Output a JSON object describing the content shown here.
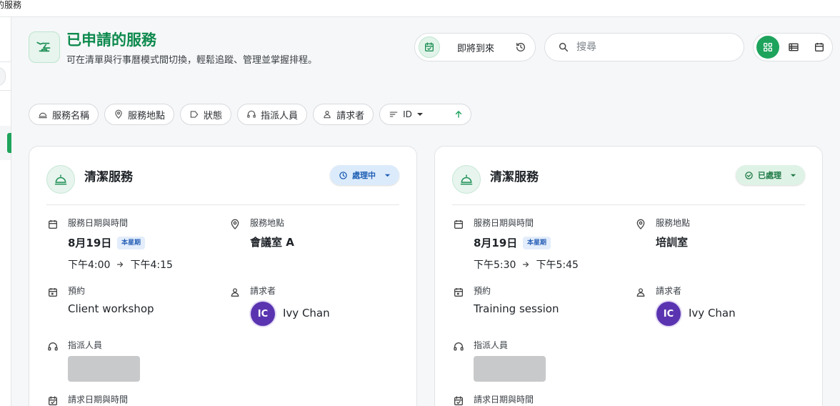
{
  "window": {
    "title": "的服務"
  },
  "header": {
    "title": "已申請的服務",
    "subtitle": "可在清單與行事曆模式間切換，輕鬆追蹤、管理並掌握排程。"
  },
  "toolbar": {
    "upcoming_label": "即將到來",
    "search_placeholder": "搜尋",
    "view_active": "grid"
  },
  "filters": [
    {
      "label": "服務名稱",
      "icon": "service-bell-icon"
    },
    {
      "label": "服務地點",
      "icon": "location-pin-icon"
    },
    {
      "label": "狀態",
      "icon": "tag-icon"
    },
    {
      "label": "指派人員",
      "icon": "headset-icon"
    },
    {
      "label": "請求者",
      "icon": "person-icon"
    }
  ],
  "sort": {
    "field": "ID",
    "direction": "ascending"
  },
  "labels": {
    "service_datetime": "服務日期與時間",
    "location": "服務地點",
    "booking": "預約",
    "requester": "請求者",
    "assignee": "指派人員",
    "request_datetime": "請求日期與時間"
  },
  "cards": [
    {
      "title": "清潔服務",
      "status": "處理中",
      "status_color": "#1e5fb4",
      "date": "8月19日",
      "week_badge": "本星期",
      "time_start": "下午4:00",
      "time_end": "下午4:15",
      "location": "會議室 A",
      "booking": "Client workshop",
      "requester_initials": "IC",
      "requester_name": "Ivy Chan"
    },
    {
      "title": "清潔服務",
      "status": "已處理",
      "status_color": "#1e7a45",
      "date": "8月19日",
      "week_badge": "本星期",
      "time_start": "下午5:30",
      "time_end": "下午5:45",
      "location": "培訓室",
      "booking": "Training session",
      "requester_initials": "IC",
      "requester_name": "Ivy Chan"
    }
  ],
  "colors": {
    "brand": "#1ea35c",
    "brand_dark": "#0e8a4e",
    "avatar": "#5a34b0"
  }
}
